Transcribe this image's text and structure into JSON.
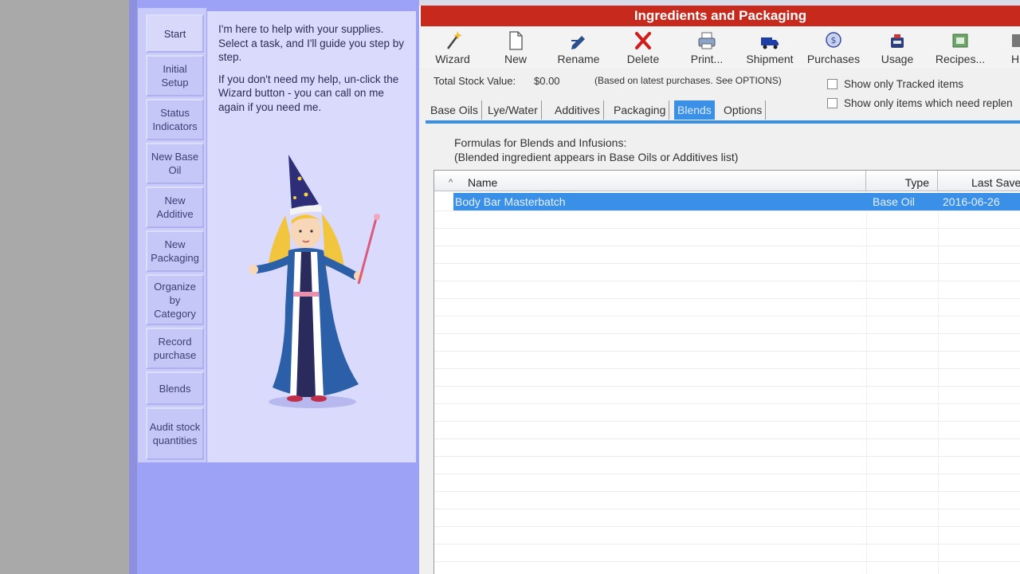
{
  "wizard": {
    "tasks": [
      "Start",
      "Initial Setup",
      "Status Indicators",
      "New Base Oil",
      "New Additive",
      "New Packaging",
      "Organize by Category",
      "Record purchase",
      "Blends",
      "Audit stock quantities"
    ],
    "help_paragraph_1": "I'm here to help with your supplies. Select a task, and I'll guide you step by step.",
    "help_paragraph_2": "If you don't need my help, un-click the Wizard button - you can call on me again if you need me."
  },
  "window": {
    "title": "Ingredients and Packaging"
  },
  "toolbar": {
    "buttons": [
      {
        "label": "Wizard",
        "icon": "wand-icon"
      },
      {
        "label": "New",
        "icon": "new-document-icon"
      },
      {
        "label": "Rename",
        "icon": "rename-icon"
      },
      {
        "label": "Delete",
        "icon": "delete-x-icon"
      },
      {
        "label": "Print...",
        "icon": "printer-icon"
      },
      {
        "label": "Shipment",
        "icon": "truck-icon"
      },
      {
        "label": "Purchases",
        "icon": "purchases-icon"
      },
      {
        "label": "Usage",
        "icon": "usage-icon"
      },
      {
        "label": "Recipes...",
        "icon": "recipes-icon"
      },
      {
        "label": "H",
        "icon": "help-icon"
      }
    ]
  },
  "stock": {
    "label": "Total Stock Value:",
    "value": "$0.00",
    "note": "(Based on latest purchases. See OPTIONS)"
  },
  "filters": {
    "tracked_label": "Show only Tracked items",
    "tracked_checked": false,
    "replenish_label": "Show only items which need replen",
    "replenish_checked": false
  },
  "tabs": [
    {
      "label": "Base Oils",
      "active": false
    },
    {
      "label": "Lye/Water",
      "active": false
    },
    {
      "label": "Additives",
      "active": false
    },
    {
      "label": "Packaging",
      "active": false
    },
    {
      "label": "Blends",
      "active": true
    },
    {
      "label": "Options",
      "active": false
    }
  ],
  "content": {
    "note_line_1": "Formulas for Blends and Infusions:",
    "note_line_2": "(Blended ingredient appears in Base Oils or Additives list)"
  },
  "grid": {
    "columns": [
      "Name",
      "Type",
      "Last Save"
    ],
    "sort_indicator": "^",
    "rows": [
      {
        "name": "Body Bar Masterbatch",
        "type": "Base Oil",
        "last_saved": "2016-06-26",
        "selected": true
      }
    ]
  },
  "colors": {
    "title_bar": "#c7291d",
    "selection": "#3a8fe6",
    "wizard_panel": "#9ea2f6"
  }
}
